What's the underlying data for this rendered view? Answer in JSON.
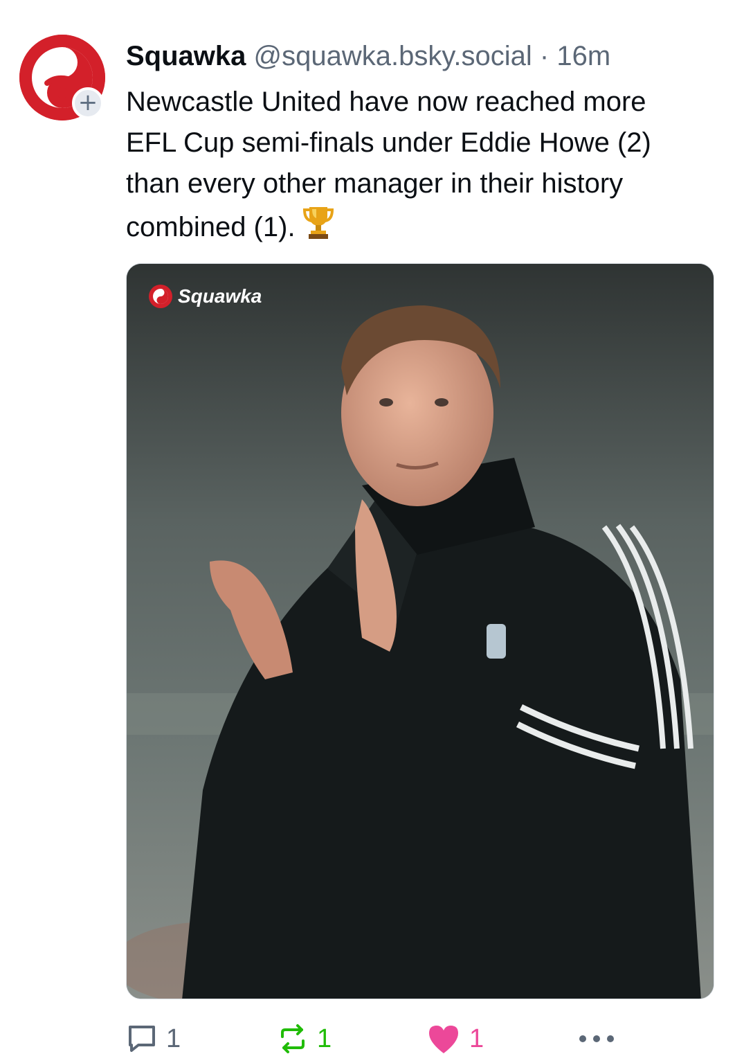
{
  "post": {
    "author": {
      "display_name": "Squawka",
      "handle": "@squawka.bsky.social",
      "separator": " · ",
      "time": "16m",
      "avatar_icon": "squawka-logo-icon",
      "follow_badge": "+"
    },
    "text": "Newcastle United have now reached more EFL Cup semi-finals under Eddie Howe (2) than every other manager in their history combined (1).",
    "text_emoji": "trophy-icon",
    "image": {
      "watermark_text": "Squawka",
      "description_icon": "photo-manager-clapping"
    },
    "actions": {
      "reply_count": "1",
      "repost_count": "1",
      "like_count": "1"
    }
  },
  "colors": {
    "brand_red": "#d3202a",
    "text": "#0b0f14",
    "muted": "#5b6776",
    "repost_green": "#20bc07",
    "like_pink": "#ec4899"
  }
}
